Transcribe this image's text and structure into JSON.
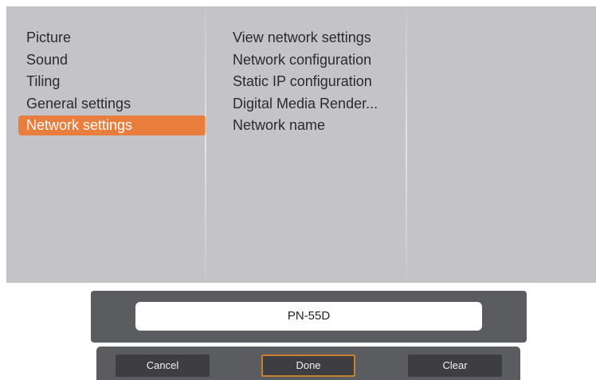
{
  "menu": {
    "categories": [
      {
        "label": "Picture"
      },
      {
        "label": "Sound"
      },
      {
        "label": "Tiling"
      },
      {
        "label": "General settings"
      },
      {
        "label": "Network settings"
      }
    ],
    "selected_index": 4,
    "submenu": [
      {
        "label": "View network settings"
      },
      {
        "label": "Network configuration"
      },
      {
        "label": "Static IP configuration"
      },
      {
        "label": "Digital Media Render..."
      },
      {
        "label": "Network name"
      }
    ]
  },
  "keyboard_dialog": {
    "input_value": "PN-55D",
    "buttons": {
      "cancel": "Cancel",
      "done": "Done",
      "clear": "Clear"
    }
  },
  "colors": {
    "panel_bg": "#c4c4c8",
    "selection": "#e97d3e",
    "dialog_bg": "#5b5c60",
    "button_bg": "#3e3e42",
    "focus_border": "#c8822f"
  }
}
